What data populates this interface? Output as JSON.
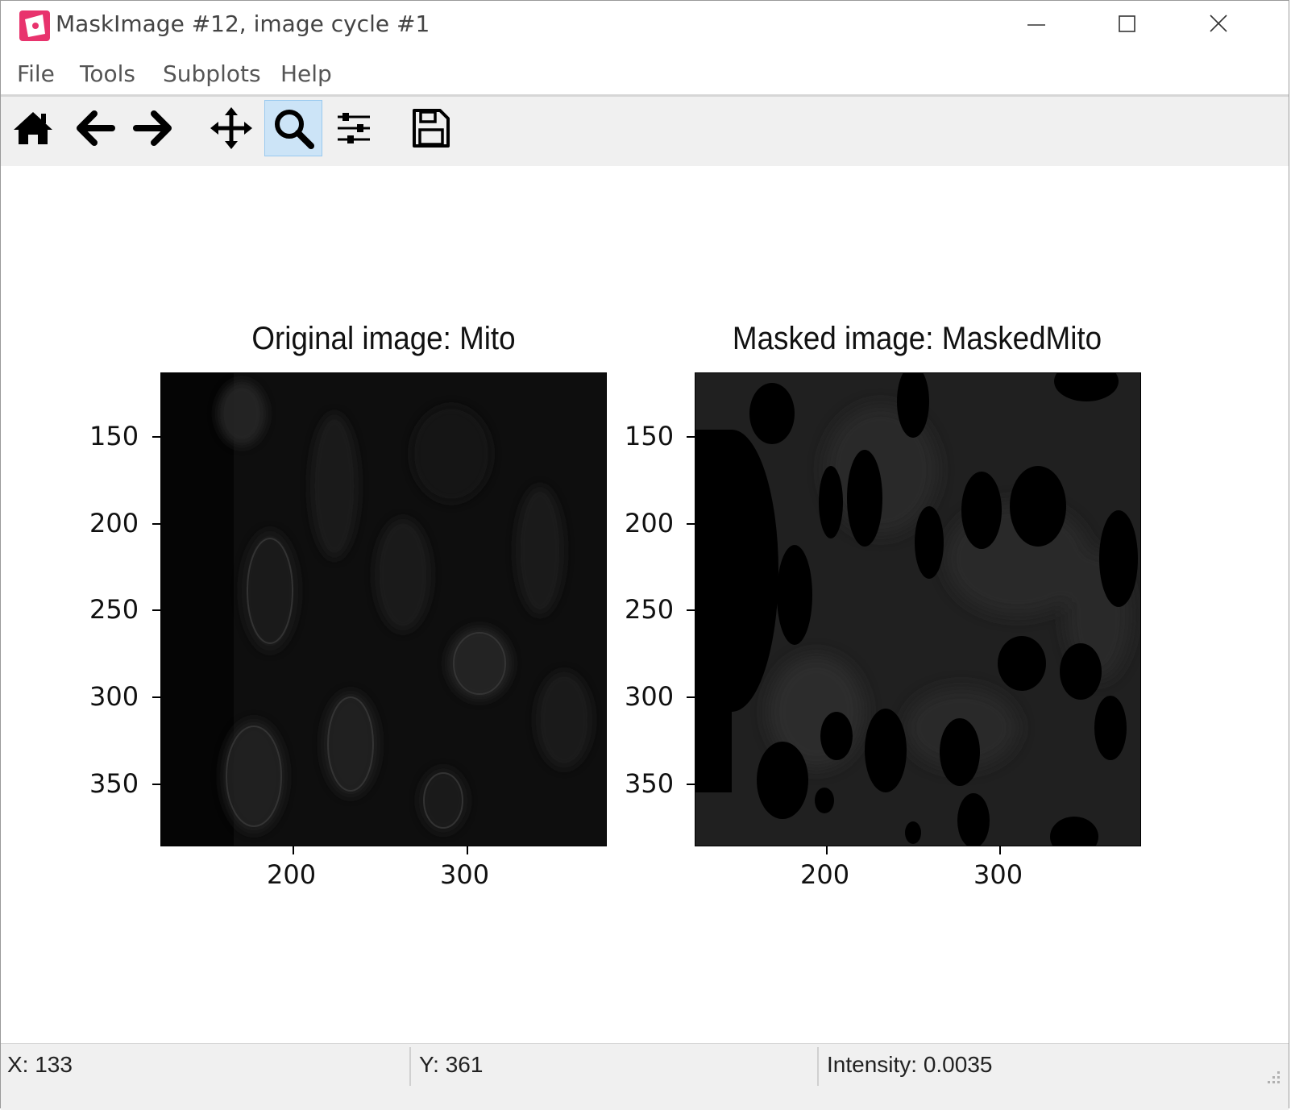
{
  "window": {
    "title": "MaskImage #12, image cycle #1",
    "icon": "cellprofiler-app-icon"
  },
  "menu": [
    "File",
    "Tools",
    "Subplots",
    "Help"
  ],
  "toolbar": {
    "tools": [
      "home-icon",
      "back-arrow-icon",
      "forward-arrow-icon",
      "pan-move-icon",
      "zoom-magnifier-icon",
      "configure-subplots-icon",
      "save-disk-icon"
    ],
    "active": "zoom-magnifier-icon"
  },
  "plots": [
    {
      "title": "Original image: Mito",
      "y_ticks": [
        "150",
        "200",
        "250",
        "300",
        "350"
      ],
      "x_ticks": [
        "200",
        "300"
      ]
    },
    {
      "title": "Masked image: MaskedMito",
      "y_ticks": [
        "150",
        "200",
        "250",
        "300",
        "350"
      ],
      "x_ticks": [
        "200",
        "300"
      ]
    }
  ],
  "status": {
    "x": "X: 133",
    "y": "Y: 361",
    "intensity": "Intensity: 0.0035"
  }
}
